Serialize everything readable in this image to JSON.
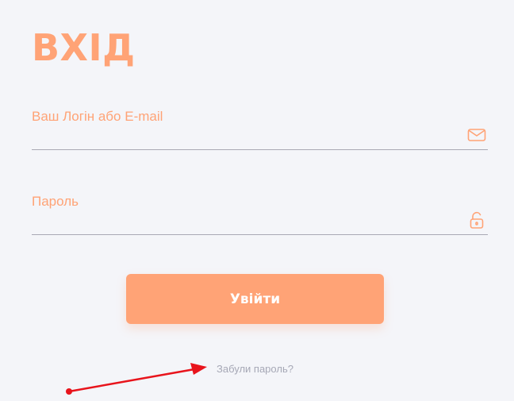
{
  "page_title": "ВХІД",
  "login_field": {
    "label": "Ваш Логін або E-mail",
    "icon": "envelope-icon"
  },
  "password_field": {
    "label": "Пароль",
    "icon": "unlock-icon"
  },
  "submit_label": "Увійти",
  "forgot_link": "Забули пароль?",
  "annotation": {
    "type": "arrow",
    "color": "#e8141c",
    "points_to": "forgot-password-link"
  },
  "colors": {
    "accent": "#ffa376",
    "background": "#f4f5f9",
    "underline": "#a9a9b4",
    "muted_link": "#a6a8b6"
  }
}
